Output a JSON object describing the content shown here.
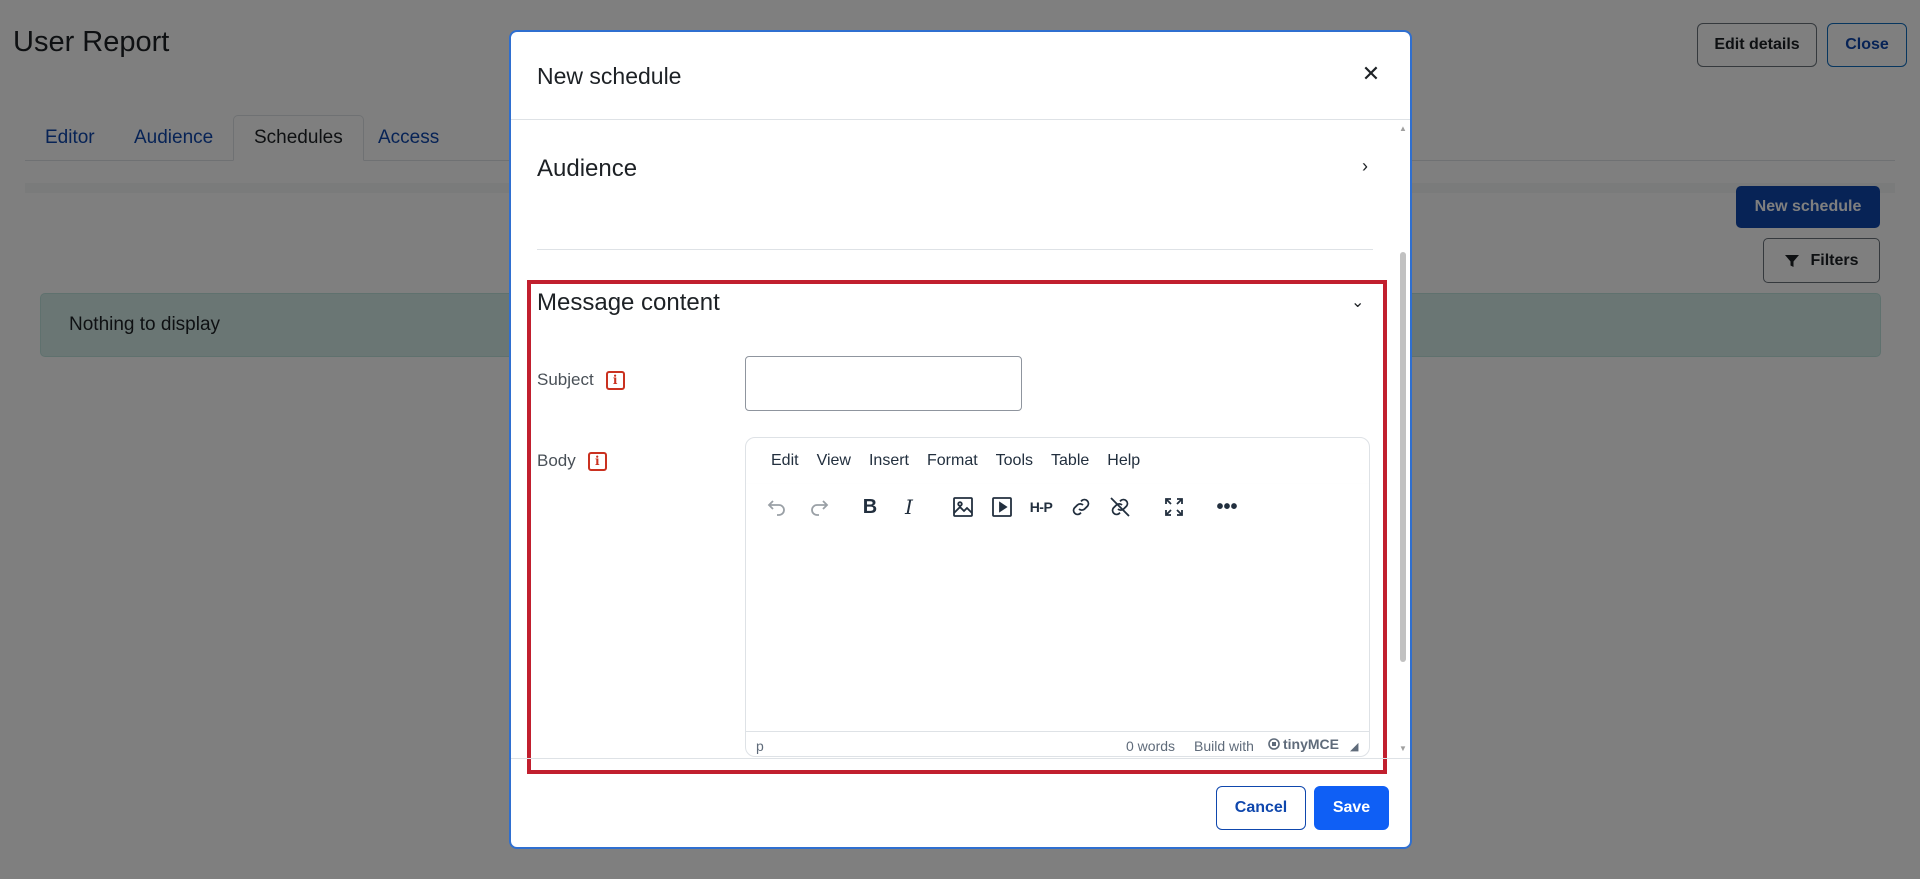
{
  "page": {
    "title": "User Report",
    "edit_details_label": "Edit details",
    "close_label": "Close",
    "tabs": [
      {
        "label": "Editor"
      },
      {
        "label": "Audience"
      },
      {
        "label": "Schedules",
        "active": true
      },
      {
        "label": "Access"
      }
    ],
    "new_schedule_label": "New schedule",
    "filters_label": "Filters",
    "empty_message": "Nothing to display"
  },
  "modal": {
    "title": "New schedule",
    "close_icon": "close-icon",
    "sections": {
      "audience": {
        "title": "Audience",
        "state": "collapsed"
      },
      "message_content": {
        "title": "Message content",
        "state": "expanded"
      }
    },
    "form": {
      "subject_label": "Subject",
      "subject_value": "",
      "body_label": "Body"
    },
    "editor": {
      "menu": [
        "Edit",
        "View",
        "Insert",
        "Format",
        "Tools",
        "Table",
        "Help"
      ],
      "toolbar": [
        "undo-icon",
        "redo-icon",
        "bold-icon",
        "italic-icon",
        "image-icon",
        "media-icon",
        "h5p-icon",
        "link-icon",
        "unlink-icon",
        "fullscreen-icon",
        "more-icon"
      ],
      "h5p_text": "H-P",
      "status_path": "p",
      "word_count": "0 words",
      "brand_prefix": "Build with",
      "brand_name": "tinyMCE"
    },
    "footer": {
      "cancel_label": "Cancel",
      "save_label": "Save"
    }
  },
  "colors": {
    "primary": "#0f47ad",
    "save": "#0f5ff5",
    "highlight": "#c11f2e",
    "notice_bg": "#d4ede9"
  }
}
